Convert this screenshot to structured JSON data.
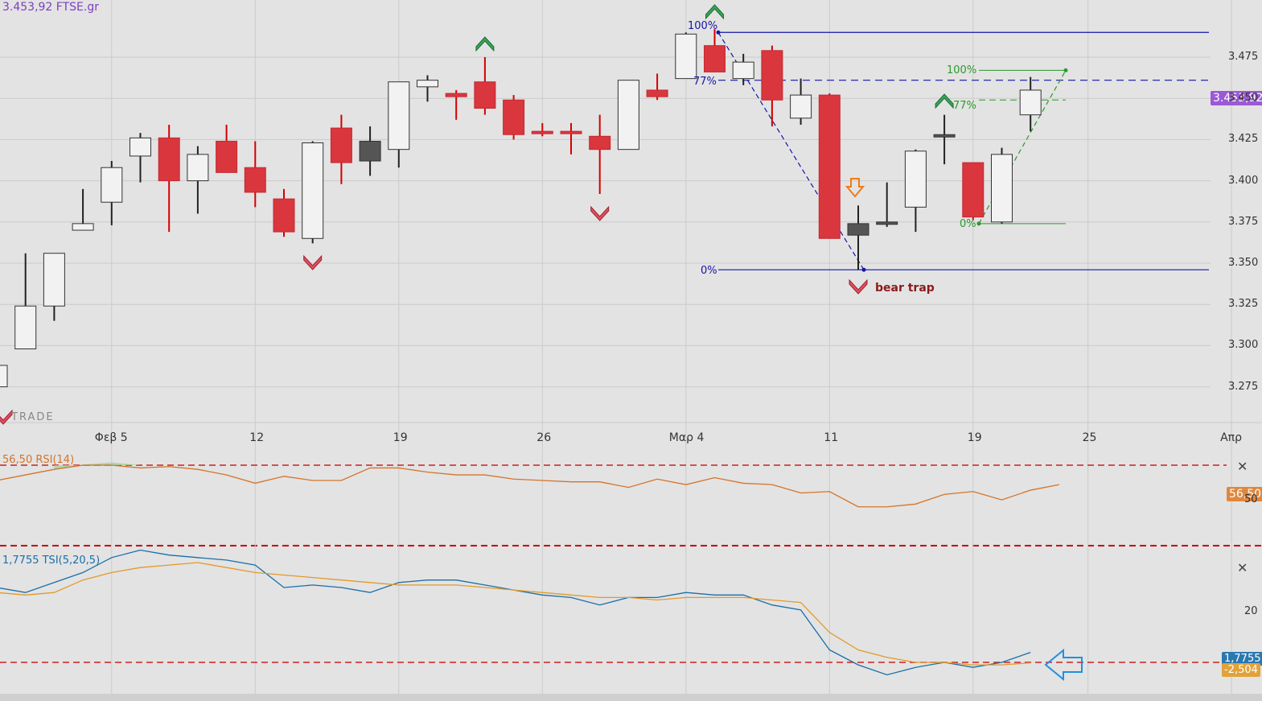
{
  "header": {
    "title": "3.453,92 FTSE.gr"
  },
  "watermark": "TRADE",
  "price_badge": "3.453,92",
  "rsi_badge": "56,50",
  "rsi_tick": "50",
  "tsi_tick": "20",
  "tsi_badge1": "1,7755",
  "tsi_badge2": "-2,504",
  "annotation": "bear trap",
  "colors": {
    "bear": "#d9363e",
    "bull": "#f2f2f2",
    "doji": "#555555",
    "fib1": "#1515a8",
    "fib2": "#2a9a2a",
    "rsi": "#d4742a",
    "tsi": "#1a6ea8",
    "signal": "#e29a2a"
  },
  "fib1": {
    "labels": [
      "100%",
      "77%",
      "0%"
    ],
    "values": [
      3490,
      3461,
      3346
    ]
  },
  "fib2": {
    "labels": [
      "100%",
      "77%",
      "0%"
    ],
    "values": [
      3467,
      3449,
      3374
    ]
  },
  "chart_data": [
    {
      "type": "candlestick",
      "title": "3.453,92 FTSE.gr",
      "x_tick_labels": [
        "Φεβ 5",
        "12",
        "19",
        "26",
        "Μαρ 4",
        "11",
        "19",
        "25",
        "Απρ"
      ],
      "y_ticks": [
        "3.475",
        "3.450",
        "3.425",
        "3.400",
        "3.375",
        "3.350",
        "3.325",
        "3.300",
        "3.275"
      ],
      "y_values": [
        3475,
        3450,
        3425,
        3400,
        3375,
        3350,
        3325,
        3300,
        3275
      ],
      "ylim": [
        3254,
        3502
      ],
      "candles": [
        {
          "o": 3275,
          "c": 3288,
          "h": 3300,
          "l": 3268,
          "t": "bull"
        },
        {
          "o": 3298,
          "c": 3324,
          "h": 3356,
          "l": 3298,
          "t": "bull"
        },
        {
          "o": 3324,
          "c": 3356,
          "h": 3356,
          "l": 3315,
          "t": "bull"
        },
        {
          "o": 3370,
          "c": 3374,
          "h": 3395,
          "l": 3370,
          "t": "bull"
        },
        {
          "o": 3387,
          "c": 3408,
          "h": 3412,
          "l": 3373,
          "t": "bull"
        },
        {
          "o": 3415,
          "c": 3426,
          "h": 3429,
          "l": 3399,
          "t": "bull"
        },
        {
          "o": 3426,
          "c": 3400,
          "h": 3434,
          "l": 3369,
          "t": "bear"
        },
        {
          "o": 3400,
          "c": 3416,
          "h": 3421,
          "l": 3380,
          "t": "bull"
        },
        {
          "o": 3424,
          "c": 3405,
          "h": 3434,
          "l": 3405,
          "t": "bear"
        },
        {
          "o": 3408,
          "c": 3393,
          "h": 3424,
          "l": 3384,
          "t": "bear"
        },
        {
          "o": 3389,
          "c": 3369,
          "h": 3395,
          "l": 3366,
          "t": "bear"
        },
        {
          "o": 3365,
          "c": 3423,
          "h": 3424,
          "l": 3362,
          "t": "bull"
        },
        {
          "o": 3432,
          "c": 3411,
          "h": 3440,
          "l": 3398,
          "t": "bear"
        },
        {
          "o": 3412,
          "c": 3424,
          "h": 3433,
          "l": 3403,
          "t": "doji"
        },
        {
          "o": 3419,
          "c": 3460,
          "h": 3460,
          "l": 3408,
          "t": "bull"
        },
        {
          "o": 3457,
          "c": 3461,
          "h": 3464,
          "l": 3448,
          "t": "bull"
        },
        {
          "o": 3453,
          "c": 3451,
          "h": 3455,
          "l": 3437,
          "t": "bear"
        },
        {
          "o": 3460,
          "c": 3444,
          "h": 3475,
          "l": 3440,
          "t": "bear"
        },
        {
          "o": 3449,
          "c": 3428,
          "h": 3452,
          "l": 3425,
          "t": "bear"
        },
        {
          "o": 3430,
          "c": 3430,
          "h": 3435,
          "l": 3427,
          "t": "bear"
        },
        {
          "o": 3430,
          "c": 3430,
          "h": 3435,
          "l": 3416,
          "t": "bear"
        },
        {
          "o": 3427,
          "c": 3419,
          "h": 3440,
          "l": 3392,
          "t": "bear"
        },
        {
          "o": 3419,
          "c": 3461,
          "h": 3461,
          "l": 3419,
          "t": "bull"
        },
        {
          "o": 3455,
          "c": 3451,
          "h": 3465,
          "l": 3449,
          "t": "bear"
        },
        {
          "o": 3462,
          "c": 3489,
          "h": 3490,
          "l": 3462,
          "t": "bull"
        },
        {
          "o": 3482,
          "c": 3466,
          "h": 3492,
          "l": 3466,
          "t": "bear"
        },
        {
          "o": 3462,
          "c": 3472,
          "h": 3477,
          "l": 3458,
          "t": "bull"
        },
        {
          "o": 3479,
          "c": 3449,
          "h": 3482,
          "l": 3433,
          "t": "bear"
        },
        {
          "o": 3438,
          "c": 3452,
          "h": 3462,
          "l": 3434,
          "t": "bull"
        },
        {
          "o": 3452,
          "c": 3365,
          "h": 3453,
          "l": 3365,
          "t": "bear"
        },
        {
          "o": 3367,
          "c": 3374,
          "h": 3385,
          "l": 3346,
          "t": "doji"
        },
        {
          "o": 3375,
          "c": 3375,
          "h": 3399,
          "l": 3372,
          "t": "doji"
        },
        {
          "o": 3384,
          "c": 3418,
          "h": 3419,
          "l": 3369,
          "t": "bull"
        },
        {
          "o": 3428,
          "c": 3428,
          "h": 3440,
          "l": 3410,
          "t": "doji"
        },
        {
          "o": 3411,
          "c": 3378,
          "h": 3411,
          "l": 3376,
          "t": "bear"
        },
        {
          "o": 3375,
          "c": 3416,
          "h": 3420,
          "l": 3374,
          "t": "bull"
        },
        {
          "o": 3440,
          "c": 3455,
          "h": 3463,
          "l": 3430,
          "t": "bull"
        }
      ]
    },
    {
      "type": "line",
      "title": "56,50 RSI(14)",
      "ylim": [
        0,
        100
      ],
      "levels": [
        70,
        30
      ],
      "values": [
        59,
        63,
        67,
        70,
        70,
        68,
        69,
        67,
        63,
        57,
        62,
        59,
        59,
        68,
        68,
        65,
        63,
        63,
        60,
        59,
        58,
        58,
        54,
        60,
        56,
        61,
        57,
        56,
        50,
        51,
        40,
        40,
        42,
        49,
        51,
        45,
        52,
        56
      ]
    },
    {
      "type": "line",
      "title": "1,7755 TSI(5,20,5)",
      "ylim": [
        -10,
        50
      ],
      "levels": [
        0
      ],
      "series": [
        {
          "name": "TSI",
          "values": [
            30,
            28,
            32,
            36,
            42,
            45,
            43,
            42,
            41,
            39,
            30,
            31,
            30,
            28,
            32,
            33,
            33,
            31,
            29,
            27,
            26,
            23,
            26,
            26,
            28,
            27,
            27,
            23,
            21,
            5,
            -1,
            -5,
            -2,
            0,
            -2,
            0,
            4
          ]
        },
        {
          "name": "Signal",
          "values": [
            28,
            27,
            28,
            33,
            36,
            38,
            39,
            40,
            38,
            36,
            35,
            34,
            33,
            32,
            31,
            31,
            31,
            30,
            29,
            28,
            27,
            26,
            26,
            25,
            26,
            26,
            26,
            25,
            24,
            12,
            5,
            2,
            0,
            0,
            -1,
            -1,
            -0.2
          ]
        }
      ]
    }
  ]
}
